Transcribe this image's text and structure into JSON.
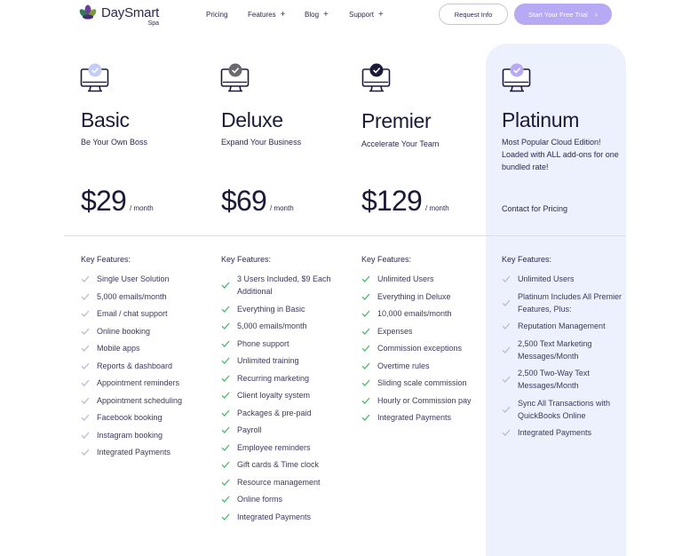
{
  "brand": {
    "name": "DaySmart",
    "sub": "Spa"
  },
  "nav": [
    {
      "label": "Pricing",
      "plus": ""
    },
    {
      "label": "Features",
      "plus": "+"
    },
    {
      "label": "Blog",
      "plus": "+"
    },
    {
      "label": "Support",
      "plus": "+"
    }
  ],
  "header_buttons": {
    "request": "Request Info",
    "trial": "Start Your Free Trial",
    "trial_chevron": "›"
  },
  "colors": {
    "accent": "#b7a9f4",
    "check_gray": "#b9bdd4",
    "check_green": "#4cb96e",
    "platinum_bg": "#edf0fd"
  },
  "plans": [
    {
      "name": "Basic",
      "tagline": "Be Your Own Boss",
      "price": "$29",
      "unit": "/ month",
      "icon": "monitor-check-icon",
      "key_features": "Key Features:",
      "features": [
        "Single User Solution",
        "5,000 emails/month",
        "Email / chat support",
        "Online booking",
        "Mobile apps",
        "Reports & dashboard",
        "Appointment reminders",
        "Appointment scheduling",
        "Facebook booking",
        "Instagram booking",
        "Integrated Payments"
      ]
    },
    {
      "name": "Deluxe",
      "tagline": "Expand Your Business",
      "price": "$69",
      "unit": "/ month",
      "icon": "monitor-check-icon",
      "key_features": "Key Features:",
      "features": [
        "3 Users Included, $9 Each Additional",
        "Everything in Basic",
        "5,000 emails/month",
        "Phone support",
        "Unlimited training",
        "Recurring marketing",
        "Client loyalty system",
        "Packages & pre-paid",
        "Payroll",
        "Employee reminders",
        "Gift cards & Time clock",
        "Resource management",
        "Online forms",
        "Integrated Payments"
      ]
    },
    {
      "name": "Premier",
      "tagline": "Accelerate Your Team",
      "price": "$129",
      "unit": "/ month",
      "icon": "monitor-check-icon",
      "key_features": "Key Features:",
      "features": [
        "Unlimited Users",
        "Everything in Deluxe",
        "10,000 emails/month",
        "Expenses",
        "Commission exceptions",
        "Overtime rules",
        "Sliding scale commission",
        "Hourly or Commission pay",
        "Integrated Payments"
      ]
    },
    {
      "name": "Platinum",
      "tagline": "Most Popular Cloud Edition! Loaded with ALL add-ons for one bundled rate!",
      "contact": "Contact for Pricing",
      "icon": "monitor-check-icon",
      "key_features": "Key Features:",
      "features": [
        "Unlimited Users",
        "Platinum Includes All Premier Features, Plus:",
        "Reputation Management",
        "2,500 Text Marketing Messages/Month",
        "2,500 Two-Way Text Messages/Month",
        "Sync All Transactions with QuickBooks Online",
        "Integrated Payments"
      ]
    }
  ]
}
